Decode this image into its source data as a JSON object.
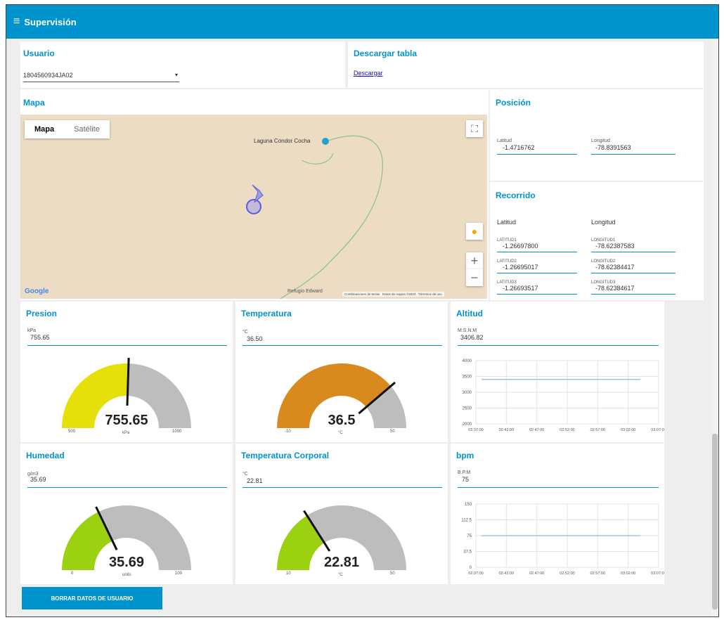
{
  "header": {
    "title": "Supervisión",
    "menu_icon": "hamburger-icon"
  },
  "usuario": {
    "title": "Usuario",
    "selected": "1804560934JA02"
  },
  "descargar": {
    "title": "Descargar tabla",
    "link": "Descargar"
  },
  "mapa": {
    "title": "Mapa",
    "tab_map": "Mapa",
    "tab_satellite": "Satélite",
    "place_label": "Laguna Condor Cocha",
    "refugio": "Refugio Edward",
    "footer_shortcuts": "Combinaciones de teclas",
    "footer_data": "Datos de mapas ©2023",
    "footer_terms": "Términos de uso",
    "google": "Google"
  },
  "posicion": {
    "title": "Posición",
    "lat_label": "Latitud",
    "lat_value": "-1.4716762",
    "lon_label": "Longitud",
    "lon_value": "-78.8391563"
  },
  "recorrido": {
    "title": "Recorrido",
    "col_lat": "Latitud",
    "col_lon": "Longitud",
    "rows": [
      {
        "lat_label": "LATITUD1",
        "lat": "-1.26697800",
        "lon_label": "LONGITUD1",
        "lon": "-78.62387583"
      },
      {
        "lat_label": "LATITUD2",
        "lat": "-1.26695017",
        "lon_label": "LONGITUD2",
        "lon": "-78.62384417"
      },
      {
        "lat_label": "LATITUD3",
        "lat": "-1.26693517",
        "lon_label": "LONGITUD3",
        "lon": "-78.62384617"
      }
    ]
  },
  "presion": {
    "title": "Presion",
    "unit": "kPa",
    "value": "755.65",
    "gauge_value": "755.65",
    "gauge_unit": "kPa",
    "min": "500",
    "max": "1000",
    "level": 0.51,
    "color": "#e6e00a"
  },
  "temperatura": {
    "title": "Temperatura",
    "unit": "°C",
    "value": "36.50",
    "gauge_value": "36.5",
    "gauge_unit": "°C",
    "min": "-10",
    "max": "50",
    "level": 0.775,
    "color": "#d98a1e"
  },
  "humedad": {
    "title": "Humedad",
    "unit": "g/m3",
    "value": "35.69",
    "gauge_value": "35.69",
    "gauge_unit": "units",
    "min": "0",
    "max": "100",
    "level": 0.357,
    "color": "#9cd111"
  },
  "temp_corporal": {
    "title": "Temperatura Corporal",
    "unit": "°C",
    "value": "22.81",
    "gauge_value": "22.81",
    "gauge_unit": "°C",
    "min": "10",
    "max": "50",
    "level": 0.32,
    "color": "#9cd111"
  },
  "altitud": {
    "title": "Altitud",
    "unit": "M.S.N.M",
    "value": "3406.82",
    "chart": {
      "yticks": [
        "4000",
        "3500",
        "3000",
        "2500",
        "2000"
      ],
      "xticks": [
        "02:37:00",
        "02:42:00",
        "02:47:00",
        "02:52:00",
        "02:57:00",
        "03:02:00",
        "03:07:00"
      ],
      "ymin": 2000,
      "ymax": 4000,
      "line_value": 3406.82
    }
  },
  "bpm": {
    "title": "bpm",
    "unit": "B.P.M",
    "value": "75",
    "chart": {
      "yticks": [
        "150",
        "112.5",
        "75",
        "37.5",
        "0"
      ],
      "xticks": [
        "02:37:00",
        "02:42:00",
        "02:47:00",
        "02:52:00",
        "02:57:00",
        "03:02:00",
        "03:07:00"
      ],
      "ymin": 0,
      "ymax": 150,
      "line_value": 75
    }
  },
  "actions": {
    "borrar": "BORRAR DATOS DE USUARIO"
  }
}
